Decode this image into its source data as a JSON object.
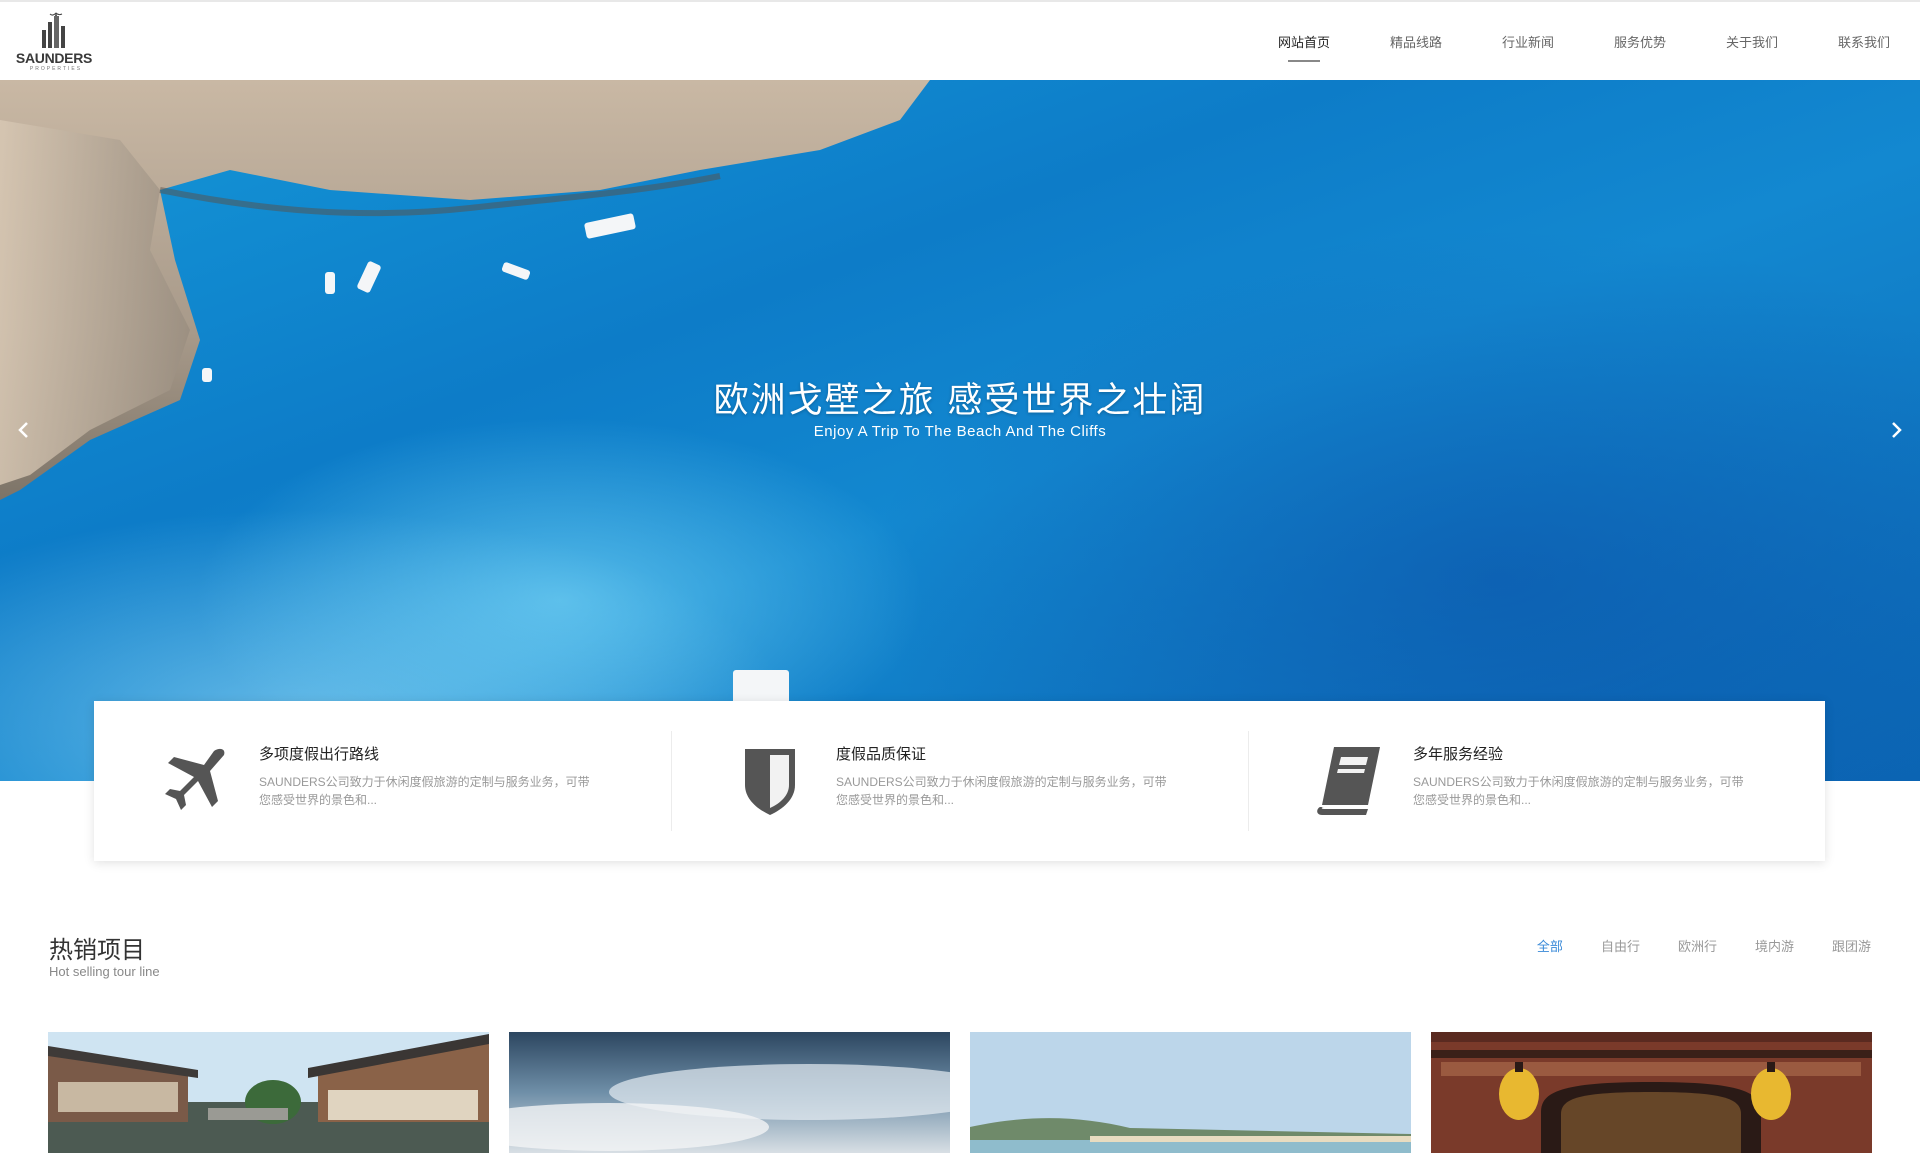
{
  "brand": {
    "name": "SAUNDERS",
    "tagline": "PROPERTIES"
  },
  "nav": {
    "items": [
      {
        "label": "网站首页",
        "active": true
      },
      {
        "label": "精品线路",
        "active": false
      },
      {
        "label": "行业新闻",
        "active": false
      },
      {
        "label": "服务优势",
        "active": false
      },
      {
        "label": "关于我们",
        "active": false
      },
      {
        "label": "联系我们",
        "active": false
      }
    ]
  },
  "hero": {
    "title": "欧洲戈壁之旅 感受世界之壮阔",
    "subtitle": "Enjoy A Trip To The Beach And The Cliffs"
  },
  "features": [
    {
      "icon": "airplane-icon",
      "title": "多项度假出行路线",
      "desc": "SAUNDERS公司致力于休闲度假旅游的定制与服务业务，可带您感受世界的景色和..."
    },
    {
      "icon": "shield-icon",
      "title": "度假品质保证",
      "desc": "SAUNDERS公司致力于休闲度假旅游的定制与服务业务，可带您感受世界的景色和..."
    },
    {
      "icon": "book-icon",
      "title": "多年服务经验",
      "desc": "SAUNDERS公司致力于休闲度假旅游的定制与服务业务，可带您感受世界的景色和..."
    }
  ],
  "hot": {
    "title": "热销项目",
    "subtitle": "Hot selling tour line",
    "filters": [
      {
        "label": "全部",
        "active": true
      },
      {
        "label": "自由行",
        "active": false
      },
      {
        "label": "欧洲行",
        "active": false
      },
      {
        "label": "境内游",
        "active": false
      },
      {
        "label": "跟团游",
        "active": false
      }
    ]
  },
  "colors": {
    "accent": "#3a8ad8",
    "sea": "#0d7cc8",
    "text": "#333333",
    "muted": "#999999"
  }
}
